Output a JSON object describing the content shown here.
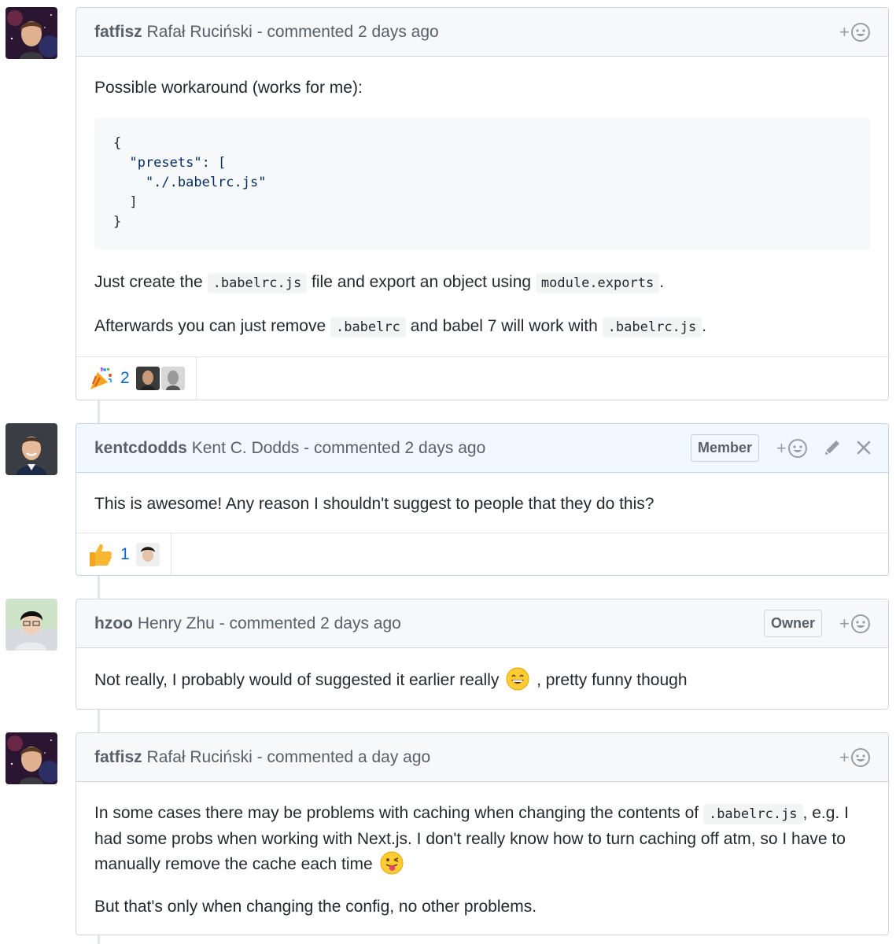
{
  "comments": [
    {
      "login": "fatfisz",
      "full_name": "Rafał Ruciński",
      "action": "- commented 2 days ago",
      "body": {
        "intro": "Possible workaround (works for me):",
        "code_lines": [
          "{",
          "  \"presets\": [",
          "    \"./.babelrc.js\"",
          "  ]",
          "}"
        ],
        "p2_before": "Just create the",
        "p2_code1": ".babelrc.js",
        "p2_middle": "file and export an object using",
        "p2_code2": "module.exports",
        "p2_after": ".",
        "p3_before": "Afterwards you can just remove",
        "p3_code1": ".babelrc",
        "p3_middle": "and babel 7 will work with",
        "p3_code2": ".babelrc.js",
        "p3_after": "."
      },
      "reaction": {
        "emoji": "party-popper-icon",
        "count": "2"
      }
    },
    {
      "login": "kentcdodds",
      "full_name": "Kent C. Dodds",
      "action": "- commented 2 days ago",
      "badge": "Member",
      "body": {
        "text": "This is awesome! Any reason I shouldn't suggest to people that they do this?"
      },
      "reaction": {
        "emoji": "thumbs-up-icon",
        "count": "1"
      }
    },
    {
      "login": "hzoo",
      "full_name": "Henry Zhu",
      "action": "- commented 2 days ago",
      "badge": "Owner",
      "body": {
        "before": "Not really, I probably would of suggested it earlier really",
        "after": ", pretty funny though"
      }
    },
    {
      "login": "fatfisz",
      "full_name": "Rafał Ruciński",
      "action": "- commented a day ago",
      "body": {
        "p1_before": "In some cases there may be problems with caching when changing the contents of",
        "p1_code": ".babelrc.js",
        "p1_after": ", e.g. I had some probs when working with Next.js. I don't really know how to turn caching off atm, so I have to manually remove the cache each time",
        "p2": "But that's only when changing the config, no other problems."
      }
    }
  ],
  "ui": {
    "plus": "+"
  },
  "colors": {
    "link": "#0366d6",
    "muted": "#586069",
    "border": "#d1d5da",
    "member_border": "#c0d3eb",
    "member_header": "#f1f8ff"
  }
}
